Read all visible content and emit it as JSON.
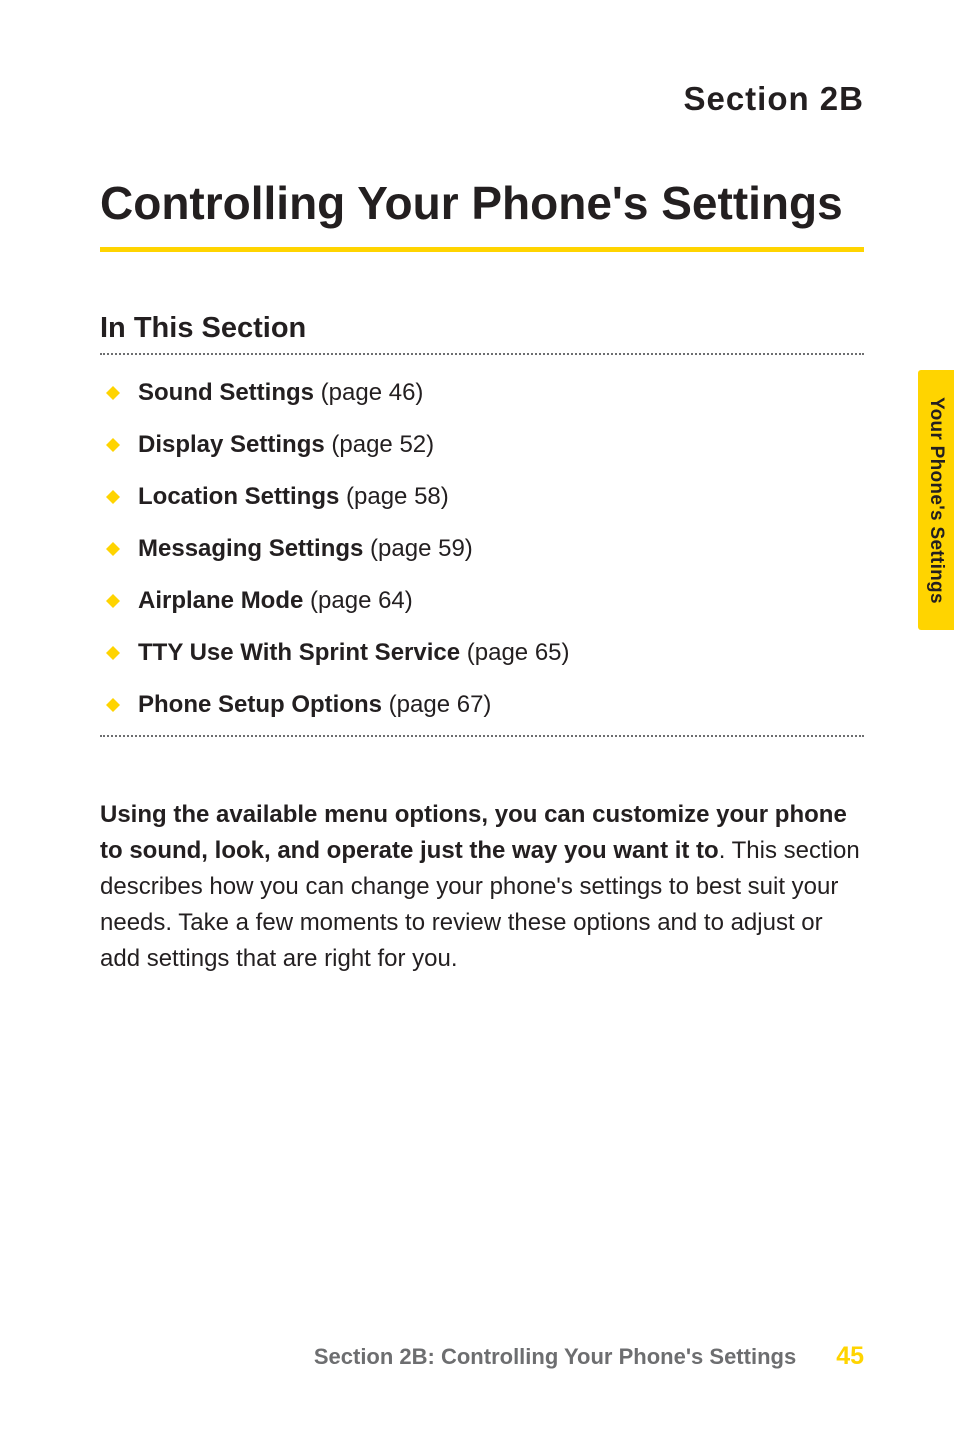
{
  "header": {
    "section_label": "Section 2B"
  },
  "title": "Controlling Your Phone's Settings",
  "subhead": "In This Section",
  "toc": [
    {
      "label": "Sound Settings",
      "page": " (page 46)"
    },
    {
      "label": "Display Settings",
      "page": " (page 52)"
    },
    {
      "label": "Location Settings",
      "page": " (page 58)"
    },
    {
      "label": "Messaging Settings",
      "page": " (page 59)"
    },
    {
      "label": "Airplane Mode",
      "page": " (page 64)"
    },
    {
      "label": "TTY Use With Sprint Service",
      "page": " (page 65)"
    },
    {
      "label": "Phone Setup Options",
      "page": " (page 67)"
    }
  ],
  "body": {
    "bold": "Using the available menu options, you can customize your phone to sound, look, and operate just the way you want it to",
    "period": ". ",
    "rest": "This section describes how you can change your phone's settings to best suit your needs. Take a few moments to review these options and to adjust or add settings that are right for you."
  },
  "side_tab": "Your Phone's Settings",
  "footer": {
    "title": "Section 2B: Controlling Your Phone's Settings",
    "page": "45"
  }
}
